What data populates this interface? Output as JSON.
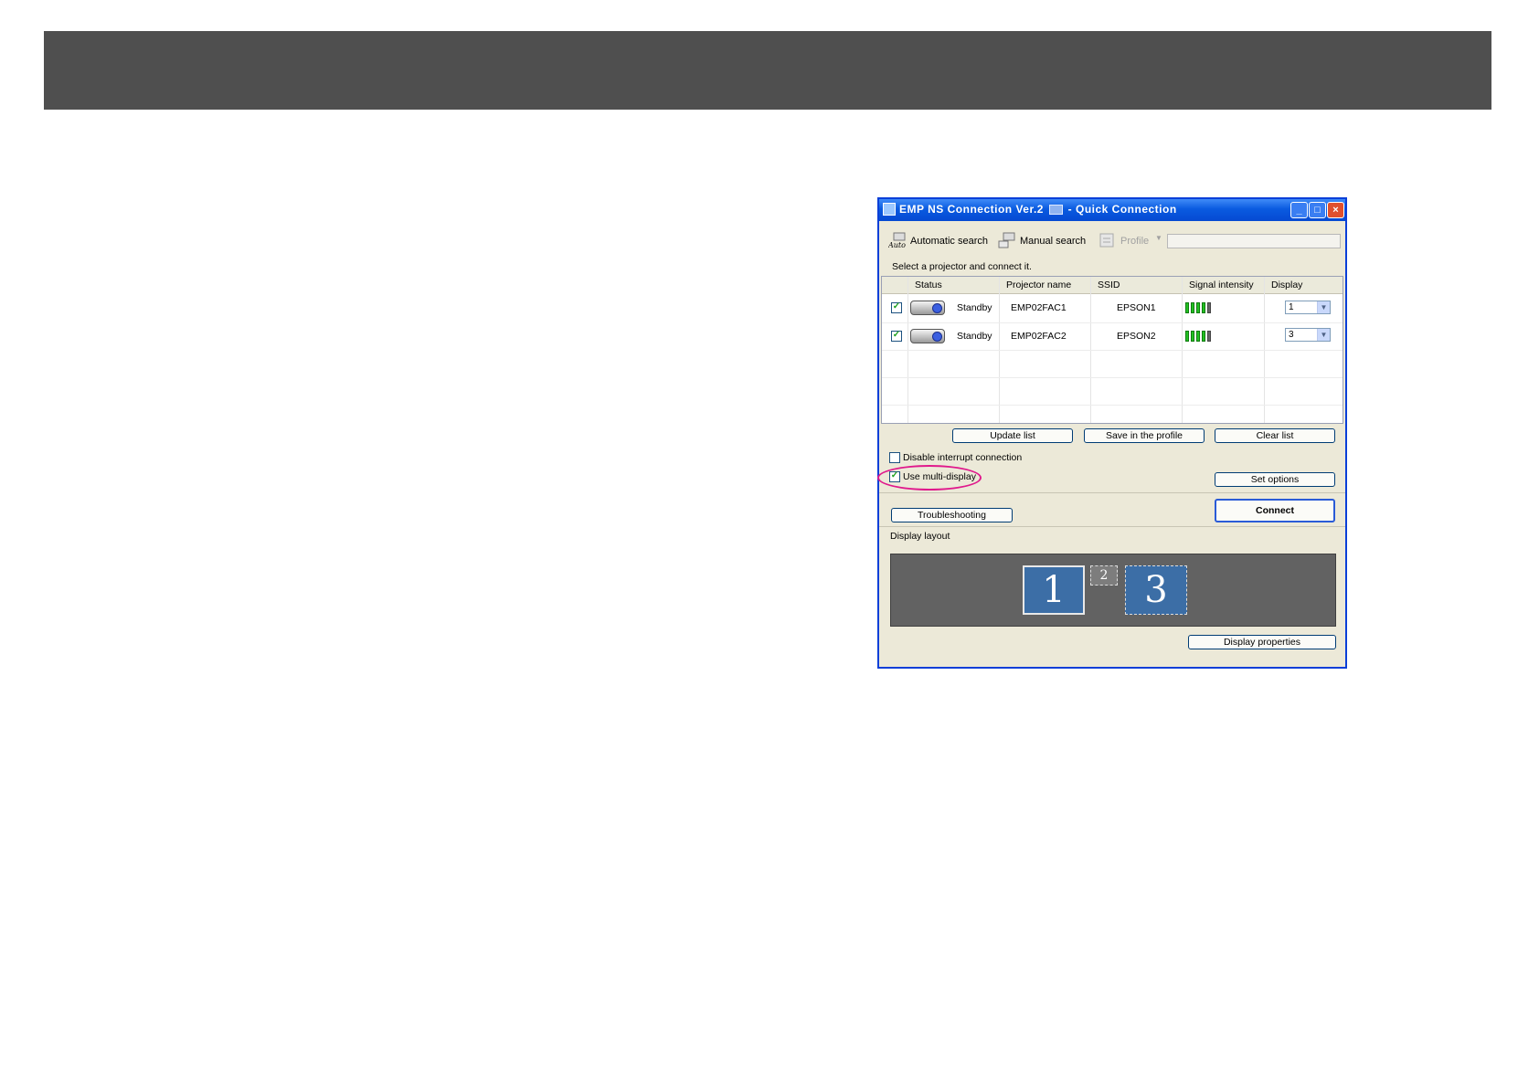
{
  "window": {
    "title_app": "EMP NS Connection Ver.2",
    "title_mode": "- Quick Connection"
  },
  "toolbar": {
    "auto_label": "Automatic search",
    "auto_icon_text": "Auto",
    "auto_icon": "auto-search-icon",
    "manual_label": "Manual search",
    "manual_icon": "manual-search-icon",
    "profile_label": "Profile",
    "profile_icon": "profile-icon"
  },
  "instruction": "Select a projector and connect it.",
  "table": {
    "columns": [
      "Status",
      "Projector name",
      "SSID",
      "Signal intensity",
      "Display"
    ],
    "rows": [
      {
        "checked": true,
        "status": "Standby",
        "name": "EMP02FAC1",
        "ssid": "EPSON1",
        "signal_bars": 4,
        "signal_max": 5,
        "display": "1"
      },
      {
        "checked": true,
        "status": "Standby",
        "name": "EMP02FAC2",
        "ssid": "EPSON2",
        "signal_bars": 4,
        "signal_max": 5,
        "display": "3"
      }
    ]
  },
  "buttons": {
    "update_list": "Update list",
    "save_profile": "Save in the profile",
    "clear_list": "Clear list",
    "set_options": "Set options",
    "connect": "Connect",
    "troubleshooting": "Troubleshooting",
    "display_properties": "Display properties"
  },
  "options": {
    "disable_interrupt": {
      "label": "Disable interrupt connection",
      "checked": false
    },
    "use_multi_display": {
      "label": "Use multi-display",
      "checked": true
    }
  },
  "display_layout": {
    "label": "Display layout",
    "displays": [
      "1",
      "2",
      "3"
    ]
  },
  "colors": {
    "banner": "#4f4f4f",
    "highlight": "#e0198c",
    "titlebar": "#0a5be0"
  }
}
